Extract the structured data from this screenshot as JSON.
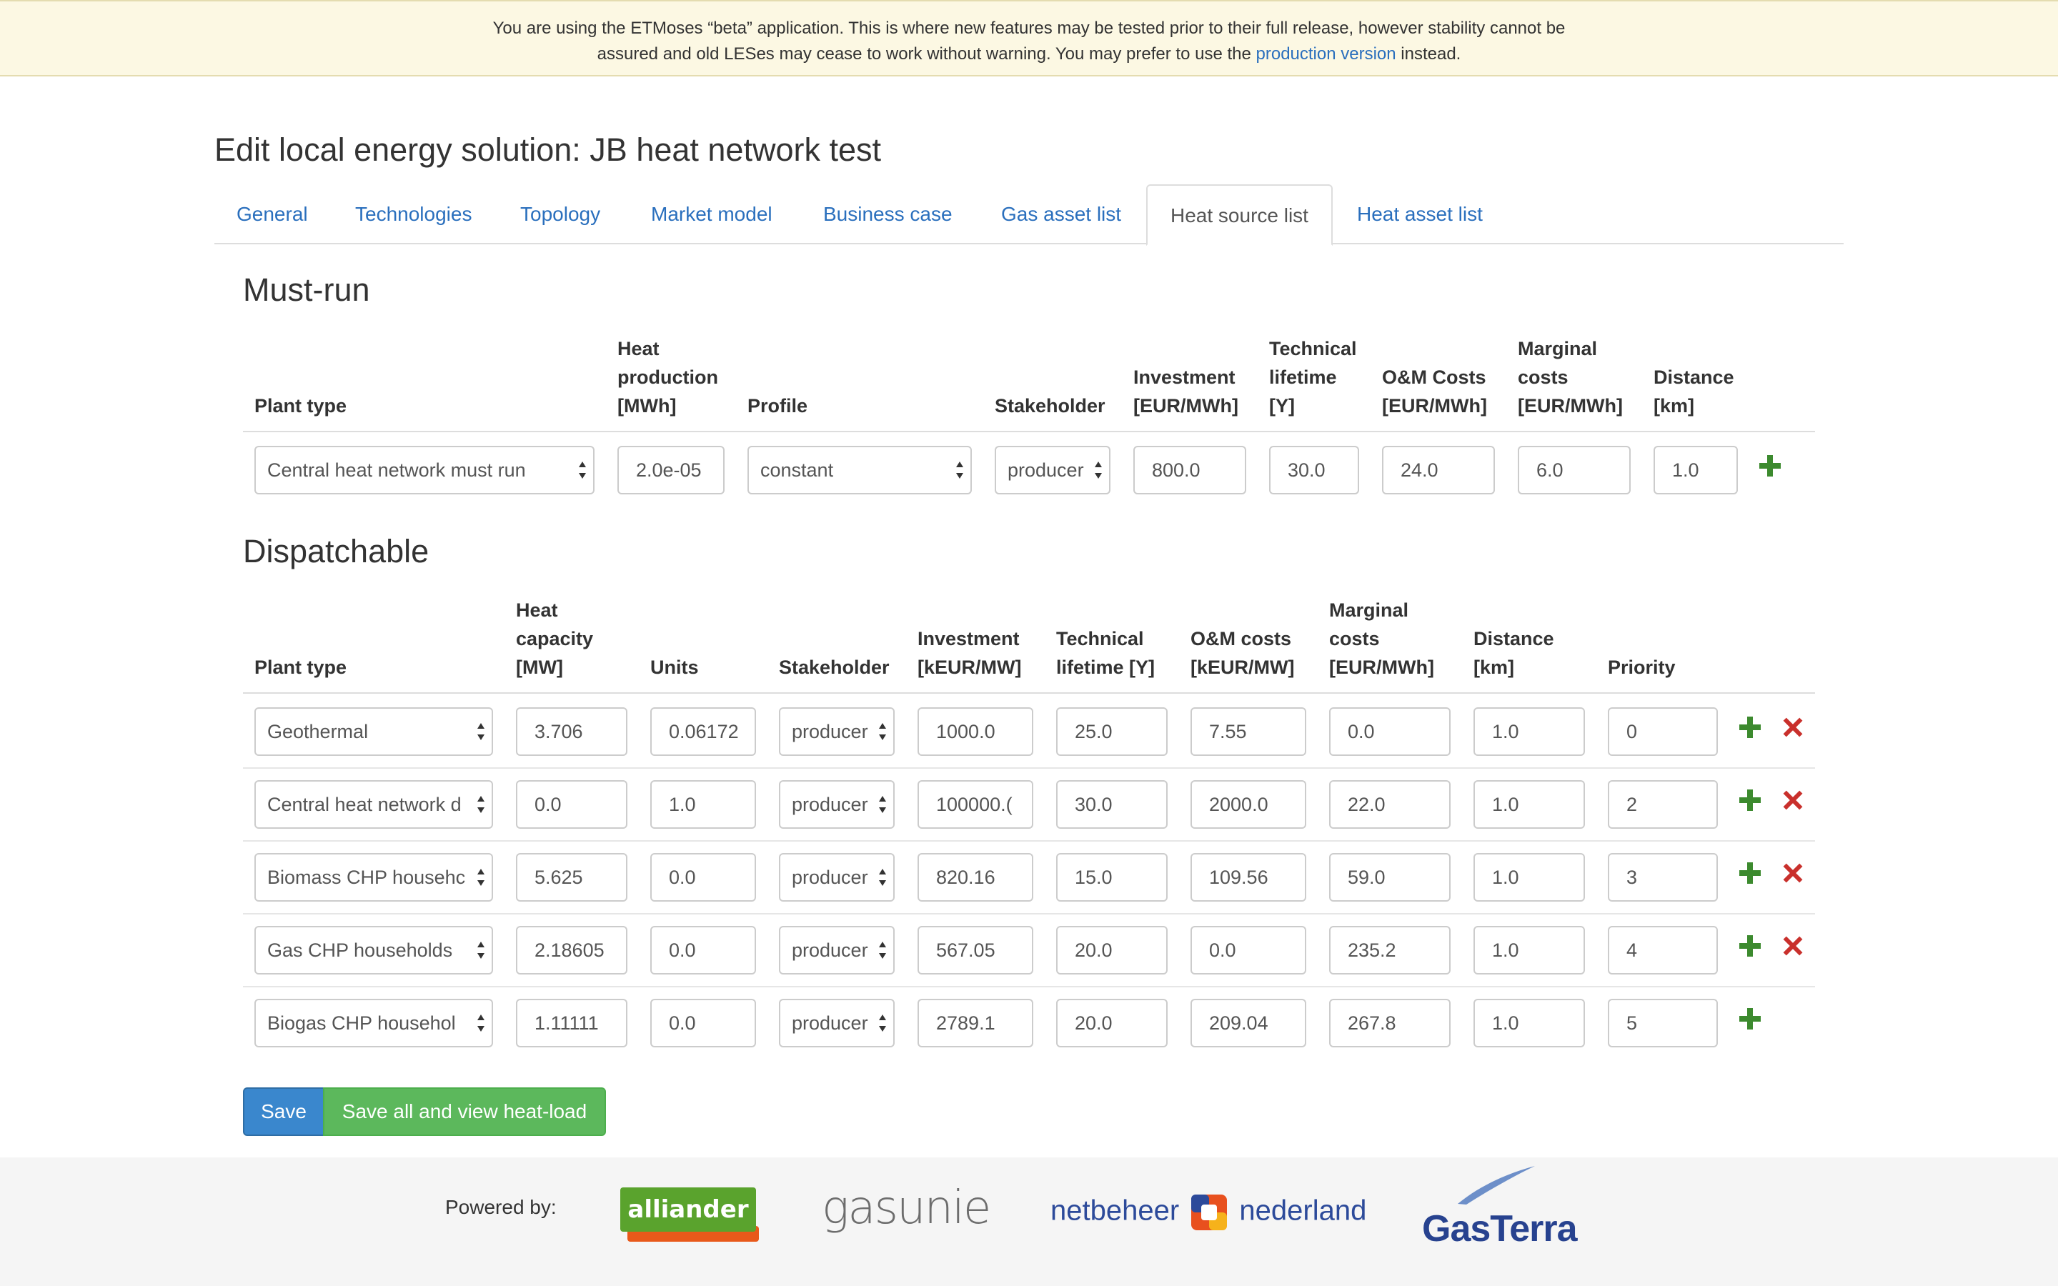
{
  "banner": {
    "line1": "You are using the ETMoses “beta” application. This is where new features may be tested prior to their full release, however stability cannot be",
    "line2_prefix": "assured and old LESes may cease to work without warning. You may prefer to use the ",
    "link": "production version",
    "line2_suffix": " instead."
  },
  "page_title": "Edit local energy solution: JB heat network test",
  "tabs": [
    {
      "label": "General"
    },
    {
      "label": "Technologies"
    },
    {
      "label": "Topology"
    },
    {
      "label": "Market model"
    },
    {
      "label": "Business case"
    },
    {
      "label": "Gas asset list"
    },
    {
      "label": "Heat source list",
      "active": true
    },
    {
      "label": "Heat asset list"
    }
  ],
  "must_run": {
    "title": "Must-run",
    "headers": {
      "plant_type": "Plant type",
      "heat_production": [
        "Heat",
        "production",
        "[MWh]"
      ],
      "profile": "Profile",
      "stakeholder": "Stakeholder",
      "investment": [
        "Investment",
        "[EUR/MWh]"
      ],
      "lifetime": [
        "Technical",
        "lifetime",
        "[Y]"
      ],
      "om": [
        "O&M Costs",
        "[EUR/MWh]"
      ],
      "marginal": [
        "Marginal",
        "costs",
        "[EUR/MWh]"
      ],
      "distance": [
        "Distance",
        "[km]"
      ]
    },
    "row": {
      "plant_type": "Central heat network must run",
      "heat_production": "2.0e-05",
      "profile": "constant",
      "stakeholder": "producer",
      "investment": "800.0",
      "lifetime": "30.0",
      "om": "24.0",
      "marginal": "6.0",
      "distance": "1.0"
    }
  },
  "dispatchable": {
    "title": "Dispatchable",
    "headers": {
      "plant_type": "Plant type",
      "capacity": [
        "Heat",
        "capacity",
        "[MW]"
      ],
      "units": "Units",
      "stakeholder": "Stakeholder",
      "investment": [
        "Investment",
        "[kEUR/MW]"
      ],
      "lifetime": [
        "Technical",
        "lifetime [Y]"
      ],
      "om": [
        "O&M costs",
        "[kEUR/MW]"
      ],
      "marginal": [
        "Marginal",
        "costs",
        "[EUR/MWh]"
      ],
      "distance": [
        "Distance",
        "[km]"
      ],
      "priority": "Priority"
    },
    "rows": [
      {
        "plant_type": "Geothermal",
        "capacity": "3.706",
        "units": "0.06172",
        "stakeholder": "producer",
        "investment": "1000.0",
        "lifetime": "25.0",
        "om": "7.55",
        "marginal": "0.0",
        "distance": "1.0",
        "priority": "0",
        "removable": true
      },
      {
        "plant_type": "Central heat network d",
        "capacity": "0.0",
        "units": "1.0",
        "stakeholder": "producer",
        "investment": "100000.(",
        "lifetime": "30.0",
        "om": "2000.0",
        "marginal": "22.0",
        "distance": "1.0",
        "priority": "2",
        "removable": true
      },
      {
        "plant_type": "Biomass CHP househc",
        "capacity": "5.625",
        "units": "0.0",
        "stakeholder": "producer",
        "investment": "820.16",
        "lifetime": "15.0",
        "om": "109.56",
        "marginal": "59.0",
        "distance": "1.0",
        "priority": "3",
        "removable": true
      },
      {
        "plant_type": "Gas CHP households",
        "capacity": "2.18605",
        "units": "0.0",
        "stakeholder": "producer",
        "investment": "567.05",
        "lifetime": "20.0",
        "om": "0.0",
        "marginal": "235.2",
        "distance": "1.0",
        "priority": "4",
        "removable": true
      },
      {
        "plant_type": "Biogas CHP househol",
        "capacity": "1.11111",
        "units": "0.0",
        "stakeholder": "producer",
        "investment": "2789.1",
        "lifetime": "20.0",
        "om": "209.04",
        "marginal": "267.8",
        "distance": "1.0",
        "priority": "5",
        "removable": false
      }
    ]
  },
  "buttons": {
    "save": "Save",
    "save_all": "Save all and view heat-load"
  },
  "footer": {
    "powered_by": "Powered by:",
    "logos": [
      "alliander",
      "gasunie",
      "netbeheer nederland",
      "GasTerra"
    ],
    "logo_alliander_text": "alliander",
    "logo_gasunie_text": "gasunie",
    "logo_netbeheer_left": "netbeheer",
    "logo_netbeheer_right": "nederland",
    "logo_gasterra_text": "GasTerra"
  },
  "colors": {
    "link": "#2a6fbd",
    "banner_bg": "#fcf8e3",
    "add": "#3c8a2e",
    "remove": "#c9302c",
    "save_btn": "#3a87cd",
    "save_all_btn": "#5cb85c"
  }
}
